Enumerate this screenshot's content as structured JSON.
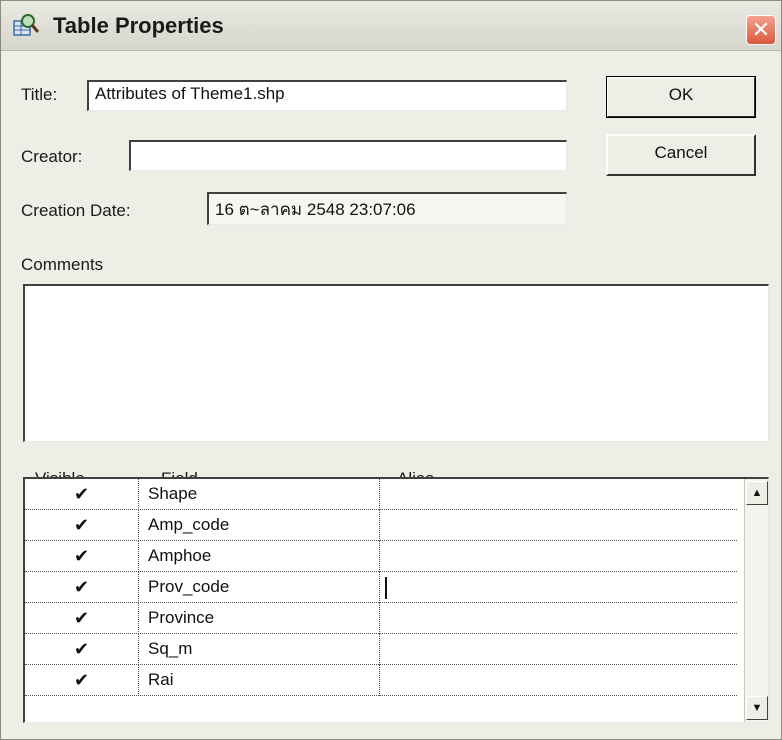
{
  "dialog": {
    "title": "Table Properties",
    "close_label": "✕",
    "icon": "table-magnifier-icon"
  },
  "form": {
    "title_label": "Title:",
    "title_value": "Attributes of Theme1.shp",
    "creator_label": "Creator:",
    "creator_value": "",
    "creation_date_label": "Creation Date:",
    "creation_date_value": "16 ต~ลาคม 2548 23:07:06",
    "comments_label": "Comments",
    "comments_value": ""
  },
  "buttons": {
    "ok": "OK",
    "cancel": "Cancel"
  },
  "grid": {
    "headers": {
      "visible": "Visible",
      "field": "Field",
      "alias": "Alias"
    },
    "rows": [
      {
        "visible": "✔",
        "field": "Shape",
        "alias": ""
      },
      {
        "visible": "✔",
        "field": "Amp_code",
        "alias": ""
      },
      {
        "visible": "✔",
        "field": "Amphoe",
        "alias": ""
      },
      {
        "visible": "✔",
        "field": "Prov_code",
        "alias": ""
      },
      {
        "visible": "✔",
        "field": "Province",
        "alias": ""
      },
      {
        "visible": "✔",
        "field": "Sq_m",
        "alias": ""
      },
      {
        "visible": "✔",
        "field": "Rai",
        "alias": ""
      }
    ]
  },
  "scroll": {
    "up": "▲",
    "down": "▼"
  },
  "colors": {
    "dialog_bg": "#efeee6",
    "close_button": "#d9583c"
  }
}
